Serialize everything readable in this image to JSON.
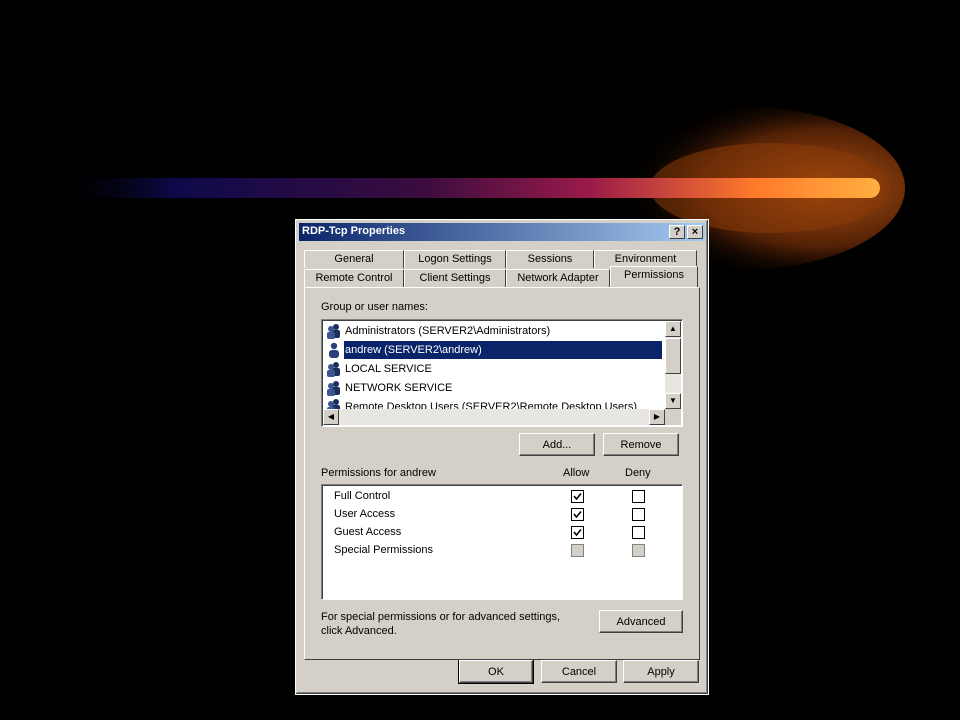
{
  "dialog": {
    "title": "RDP-Tcp Properties",
    "help_button": "?",
    "close_button": "×"
  },
  "tabs": {
    "row1": [
      "General",
      "Logon Settings",
      "Sessions",
      "Environment"
    ],
    "row2": [
      "Remote Control",
      "Client Settings",
      "Network Adapter",
      "Permissions"
    ],
    "active": "Permissions"
  },
  "groups": {
    "label": "Group or user names:",
    "items": [
      {
        "name": "Administrators (SERVER2\\Administrators)",
        "icon": "user-group-icon"
      },
      {
        "name": "andrew (SERVER2\\andrew)",
        "icon": "user-icon",
        "selected": true
      },
      {
        "name": "LOCAL SERVICE",
        "icon": "user-group-icon"
      },
      {
        "name": "NETWORK SERVICE",
        "icon": "user-group-icon"
      },
      {
        "name": "Remote Desktop Users (SERVER2\\Remote Desktop Users)",
        "icon": "user-group-icon"
      }
    ],
    "add_label": "Add...",
    "remove_label": "Remove"
  },
  "permissions": {
    "label": "Permissions for andrew",
    "allow_header": "Allow",
    "deny_header": "Deny",
    "rows": [
      {
        "name": "Full Control",
        "allow": true,
        "deny": false,
        "disabled": false
      },
      {
        "name": "User Access",
        "allow": true,
        "deny": false,
        "disabled": false
      },
      {
        "name": "Guest Access",
        "allow": true,
        "deny": false,
        "disabled": false
      },
      {
        "name": "Special Permissions",
        "allow": false,
        "deny": false,
        "disabled": true
      }
    ]
  },
  "advanced": {
    "note_line1": "For special permissions or for advanced settings,",
    "note_line2": "click Advanced.",
    "button_label": "Advanced"
  },
  "footer": {
    "ok_label": "OK",
    "cancel_label": "Cancel",
    "apply_label": "Apply"
  },
  "colors": {
    "background": "#000000",
    "dialog_face": "#d4d0c8",
    "title_start": "#0a246a",
    "title_end": "#a6caf0",
    "selection": "#0a246a",
    "streak_orange": "#ff9a1a"
  }
}
